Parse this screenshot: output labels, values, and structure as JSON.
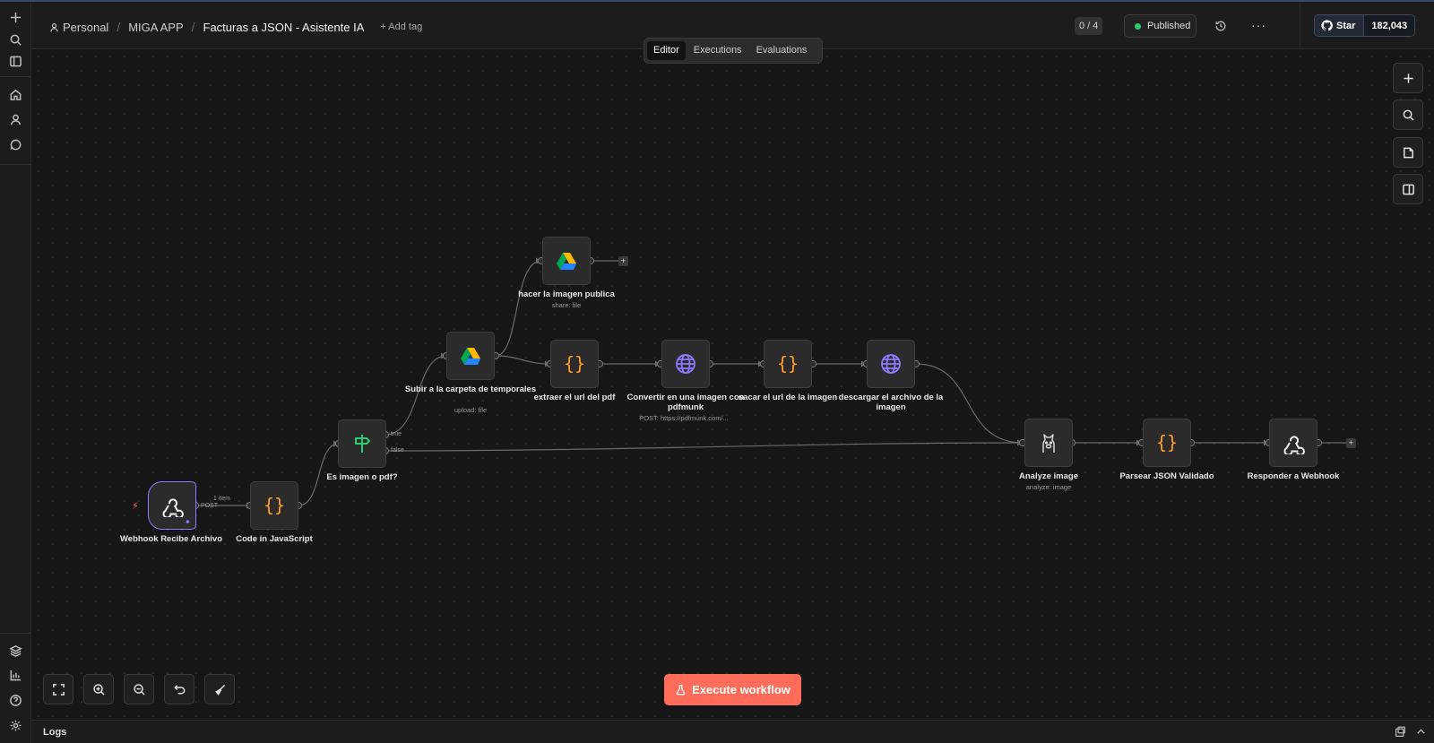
{
  "breadcrumb": {
    "personal": "Personal",
    "project": "MIGA APP",
    "workflow_title": "Facturas a JSON - Asistente IA",
    "add_tag": "+ Add tag"
  },
  "header": {
    "counter": "0 / 4",
    "published": "Published",
    "more": "···"
  },
  "github": {
    "star_label": "Star",
    "star_count": "182,043"
  },
  "tabs": [
    {
      "label": "Editor",
      "active": true
    },
    {
      "label": "Executions",
      "active": false
    },
    {
      "label": "Evaluations",
      "active": false
    }
  ],
  "nodes": [
    {
      "id": "webhook",
      "label": "Webhook Recibe Archivo",
      "sub": "",
      "icon": "webhook-icon"
    },
    {
      "id": "code_js",
      "label": "Code in JavaScript",
      "sub": "",
      "icon": "code-braces-icon"
    },
    {
      "id": "if",
      "label": "Es imagen o pdf?",
      "sub": "",
      "icon": "signpost-icon"
    },
    {
      "id": "gdrive_upload",
      "label": "Subir a la carpeta de temporales",
      "sub": "upload: file",
      "icon": "google-drive-icon"
    },
    {
      "id": "gdrive_share",
      "label": "hacer la imagen publica",
      "sub": "share: file",
      "icon": "google-drive-icon"
    },
    {
      "id": "extract_url",
      "label": "extraer el url del pdf",
      "sub": "",
      "icon": "code-braces-icon"
    },
    {
      "id": "pdfmunk",
      "label": "Convertir en una imagen con pdfmunk",
      "sub": "POST: https://pdfmunk.com/...",
      "icon": "globe-icon"
    },
    {
      "id": "get_image_url",
      "label": "sacar el url de la imagen",
      "sub": "",
      "icon": "code-braces-icon"
    },
    {
      "id": "download_image",
      "label": "descargar el archivo de la imagen",
      "sub": "",
      "icon": "globe-icon"
    },
    {
      "id": "analyze",
      "label": "Analyze image",
      "sub": "analyze: image",
      "icon": "ollama-icon"
    },
    {
      "id": "parse_json",
      "label": "Parsear JSON Validado",
      "sub": "",
      "icon": "code-braces-icon"
    },
    {
      "id": "respond",
      "label": "Responder a Webhook",
      "sub": "",
      "icon": "webhook-icon"
    }
  ],
  "edge_labels": {
    "items": "1 item",
    "post": "POST",
    "true": "true",
    "false": "false",
    "plus": "+"
  },
  "execute_button": "Execute workflow",
  "logs_label": "Logs",
  "colors": {
    "accent": "#ff6d5a",
    "trigger_border": "#8a7cff",
    "code_icon": "#ff9b26",
    "globe_icon": "#8a7cff",
    "if_icon": "#2ecc71",
    "published_dot": "#2ecc71"
  }
}
